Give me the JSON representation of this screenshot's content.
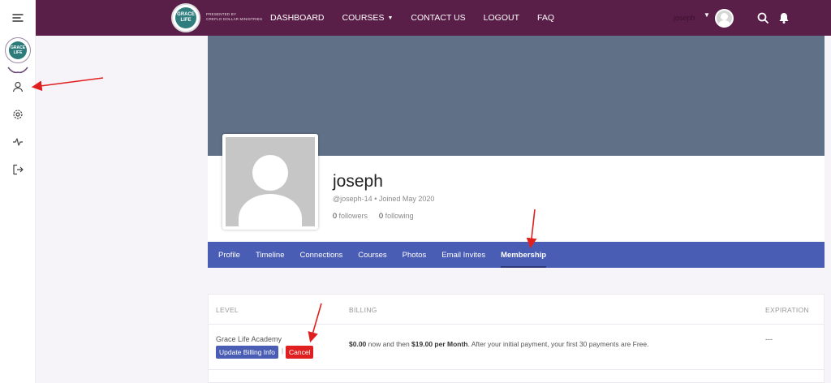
{
  "topbar": {
    "logo_text": "GRACE LIFE",
    "presented_line1": "PRESENTED BY",
    "presented_line2": "CREFLO DOLLAR MINISTRIES",
    "nav": [
      {
        "label": "DASHBOARD"
      },
      {
        "label": "COURSES",
        "has_dropdown": true
      },
      {
        "label": "CONTACT US"
      },
      {
        "label": "LOGOUT"
      },
      {
        "label": "FAQ"
      }
    ],
    "user_name": "joseph",
    "brand_color": "#5a1f48"
  },
  "rail": {
    "logo_text": "GRACE LIFE",
    "logo_ring_text": "GRACE LIFE ACADEMY",
    "items": [
      "profile-icon",
      "settings-icon",
      "activity-icon",
      "logout-icon"
    ]
  },
  "profile": {
    "name": "joseph",
    "handle": "@joseph-14",
    "joined": "Joined May 2020",
    "followers_count": "0",
    "followers_label": "followers",
    "following_count": "0",
    "following_label": "following"
  },
  "tabs": [
    {
      "label": "Profile"
    },
    {
      "label": "Timeline"
    },
    {
      "label": "Connections"
    },
    {
      "label": "Courses"
    },
    {
      "label": "Photos"
    },
    {
      "label": "Email Invites"
    },
    {
      "label": "Membership",
      "active": true
    }
  ],
  "membership": {
    "headers": {
      "level": "LEVEL",
      "billing": "BILLING",
      "expiration": "EXPIRATION"
    },
    "row": {
      "level": "Grace Life Academy",
      "update_label": "Update Billing Info",
      "separator": "|",
      "cancel_label": "Cancel",
      "billing_amount_now": "$0.00",
      "billing_text_1": " now and then ",
      "billing_recurring": "$19.00 per Month",
      "billing_text_2": ". After your initial payment, your first 30 payments are Free.",
      "expiration": "---"
    }
  },
  "colors": {
    "accent": "#4a5db5",
    "cover": "#607087",
    "cancel": "#e02020",
    "arrow": "#e0201e"
  }
}
